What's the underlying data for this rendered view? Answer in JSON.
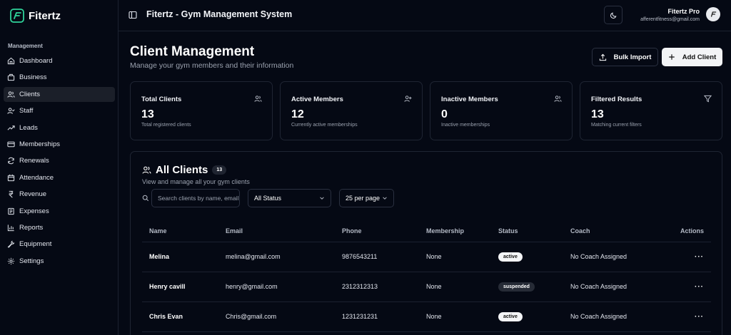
{
  "brand": {
    "name": "Fitertz"
  },
  "sidebar": {
    "section_label": "Management",
    "items": [
      {
        "label": "Dashboard",
        "icon": "home-icon",
        "active": false
      },
      {
        "label": "Business",
        "icon": "building-icon",
        "active": false
      },
      {
        "label": "Clients",
        "icon": "users-icon",
        "active": true
      },
      {
        "label": "Staff",
        "icon": "user-check-icon",
        "active": false
      },
      {
        "label": "Leads",
        "icon": "trending-icon",
        "active": false
      },
      {
        "label": "Memberships",
        "icon": "credit-card-icon",
        "active": false
      },
      {
        "label": "Renewals",
        "icon": "refresh-icon",
        "active": false
      },
      {
        "label": "Attendance",
        "icon": "calendar-icon",
        "active": false
      },
      {
        "label": "Revenue",
        "icon": "rupee-icon",
        "active": false
      },
      {
        "label": "Expenses",
        "icon": "receipt-icon",
        "active": false
      },
      {
        "label": "Reports",
        "icon": "bar-chart-icon",
        "active": false
      },
      {
        "label": "Equipment",
        "icon": "wrench-icon",
        "active": false
      },
      {
        "label": "Settings",
        "icon": "gear-icon",
        "active": false
      }
    ]
  },
  "header": {
    "title": "Fitertz - Gym Management System",
    "user_name": "Fitertz Pro",
    "user_email": "afferentfitness@gmail.com"
  },
  "page": {
    "title": "Client Management",
    "subtitle": "Manage your gym members and their information",
    "bulk_import_label": "Bulk Import",
    "add_client_label": "Add Client"
  },
  "stats": [
    {
      "title": "Total Clients",
      "value": "13",
      "desc": "Total registered clients",
      "icon": "users-icon"
    },
    {
      "title": "Active Members",
      "value": "12",
      "desc": "Currently active memberships",
      "icon": "user-plus-icon"
    },
    {
      "title": "Inactive Members",
      "value": "0",
      "desc": "Inactive memberships",
      "icon": "users-icon"
    },
    {
      "title": "Filtered Results",
      "value": "13",
      "desc": "Matching current filters",
      "icon": "filter-icon"
    }
  ],
  "clients_panel": {
    "title": "All Clients",
    "count": "13",
    "subtitle": "View and manage all your gym clients",
    "search_placeholder": "Search clients by name, email",
    "status_filter": "All Status",
    "per_page": "25 per page",
    "columns": [
      "Name",
      "Email",
      "Phone",
      "Membership",
      "Status",
      "Coach",
      "Actions"
    ],
    "rows": [
      {
        "name": "Melina",
        "email": "melina@gmail.com",
        "phone": "9876543211",
        "membership": "None",
        "status": "active",
        "coach": "No Coach Assigned"
      },
      {
        "name": "Henry cavill",
        "email": "henry@gmail.com",
        "phone": "2312312313",
        "membership": "None",
        "status": "suspended",
        "coach": "No Coach Assigned"
      },
      {
        "name": "Chris Evan",
        "email": "Chris@gmail.com",
        "phone": "1231231231",
        "membership": "None",
        "status": "active",
        "coach": "No Coach Assigned"
      }
    ]
  },
  "colors": {
    "background": "#050914",
    "accent": "#2fd39a",
    "border": "#1f2533"
  }
}
